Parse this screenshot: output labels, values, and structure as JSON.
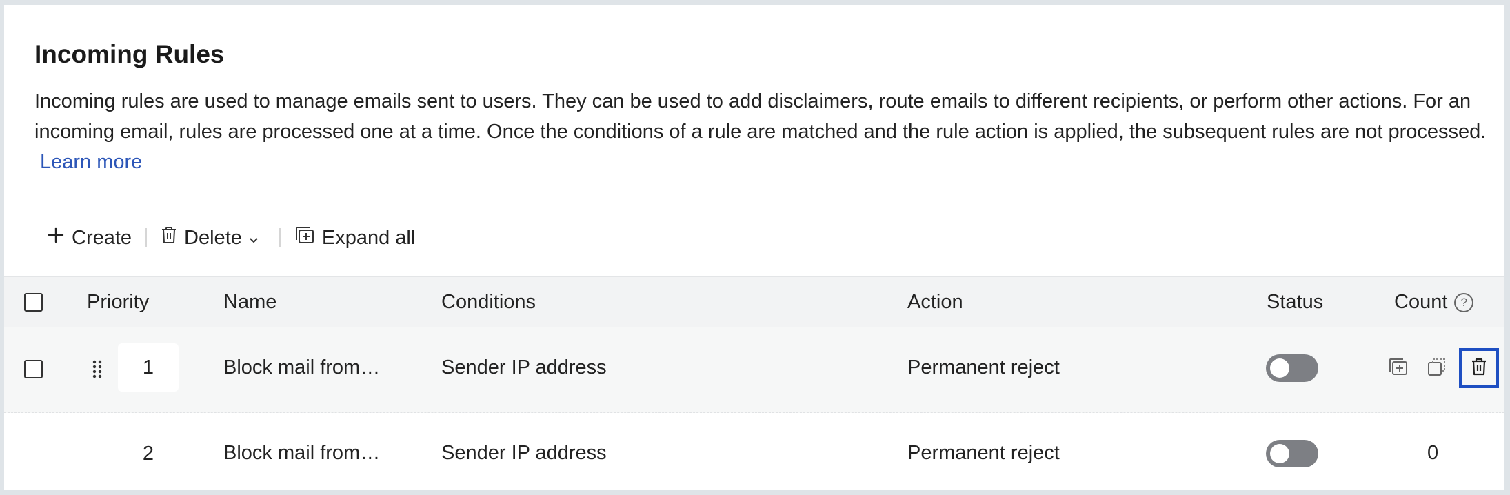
{
  "header": {
    "title": "Incoming Rules",
    "description": "Incoming rules are used to manage emails sent to users. They can be used to add disclaimers, route emails to different recipients, or perform other actions. For an incoming email, rules are processed one at a time. Once the conditions of a rule are matched and the rule action is applied, the subsequent rules are not processed.",
    "learn_more": "Learn more"
  },
  "toolbar": {
    "create_label": "Create",
    "delete_label": "Delete",
    "expand_label": "Expand all"
  },
  "table": {
    "columns": {
      "priority": "Priority",
      "name": "Name",
      "conditions": "Conditions",
      "action": "Action",
      "status": "Status",
      "count": "Count"
    },
    "rows": [
      {
        "priority": "1",
        "name": "Block mail from…",
        "conditions": "Sender IP address",
        "action": "Permanent reject",
        "status": "off",
        "count": ""
      },
      {
        "priority": "2",
        "name": "Block mail from…",
        "conditions": "Sender IP address",
        "action": "Permanent reject",
        "status": "off",
        "count": "0"
      }
    ]
  },
  "icons": {
    "create": "plus-icon",
    "delete": "trash-icon",
    "expand": "expand-all-icon",
    "help": "question-circle-icon",
    "drag": "drag-handle-icon",
    "duplicate": "duplicate-icon",
    "copy": "copy-icon"
  },
  "colors": {
    "accent": "#2c56b8",
    "focus_outline": "#1e4fc2",
    "toggle_off": "#7d7f84",
    "header_bg": "#f2f3f4"
  }
}
